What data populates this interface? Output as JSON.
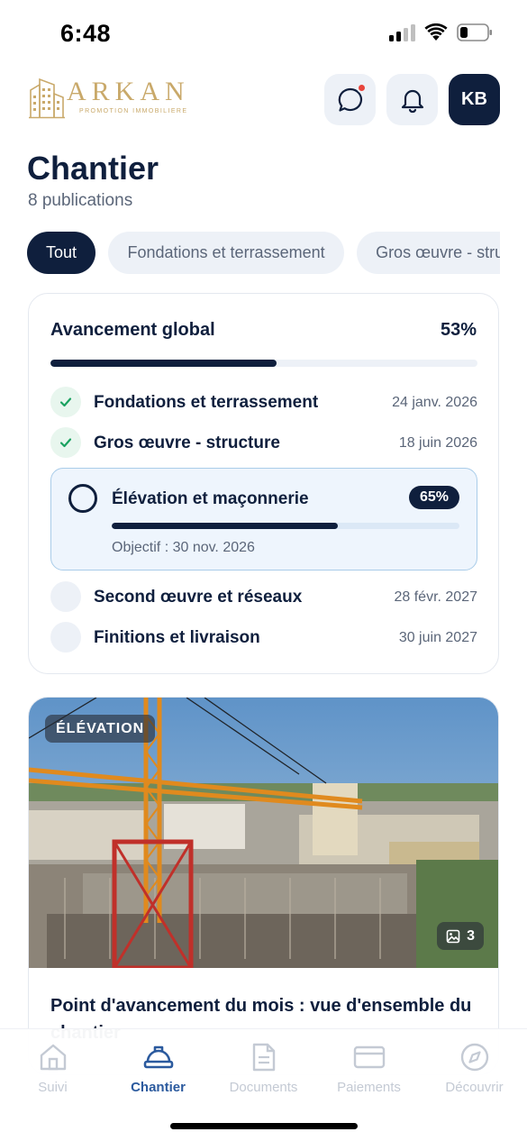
{
  "status_bar": {
    "time": "6:48"
  },
  "brand": {
    "name": "ARKAN",
    "tagline": "PROMOTION IMMOBILIERE",
    "color": "#c9a96a"
  },
  "header": {
    "avatar_initials": "KB",
    "chat_icon": "chat-bubble-icon",
    "bell_icon": "bell-icon",
    "has_notification": true
  },
  "page": {
    "title": "Chantier",
    "subtitle": "8 publications"
  },
  "filters": [
    {
      "label": "Tout",
      "active": true
    },
    {
      "label": "Fondations et terrassement",
      "active": false
    },
    {
      "label": "Gros œuvre - structure",
      "active": false
    }
  ],
  "progress": {
    "title": "Avancement global",
    "percent_label": "53%",
    "percent": 53,
    "steps": [
      {
        "label": "Fondations et terrassement",
        "date": "24 janv. 2026",
        "status": "done"
      },
      {
        "label": "Gros œuvre - structure",
        "date": "18 juin 2026",
        "status": "done"
      },
      {
        "label": "Élévation et maçonnerie",
        "badge": "65%",
        "percent": 65,
        "objective": "Objectif : 30 nov. 2026",
        "status": "current"
      },
      {
        "label": "Second œuvre et réseaux",
        "date": "28 févr. 2027",
        "status": "pending"
      },
      {
        "label": "Finitions et livraison",
        "date": "30 juin 2027",
        "status": "pending"
      }
    ]
  },
  "post": {
    "tag": "ÉLÉVATION",
    "photo_count": "3",
    "title": "Point d'avancement du mois : vue d'ensemble du chantier"
  },
  "nav": [
    {
      "label": "Suivi",
      "icon": "home-icon",
      "active": false
    },
    {
      "label": "Chantier",
      "icon": "hard-hat-icon",
      "active": true
    },
    {
      "label": "Documents",
      "icon": "document-icon",
      "active": false
    },
    {
      "label": "Paiements",
      "icon": "credit-card-icon",
      "active": false
    },
    {
      "label": "Découvrir",
      "icon": "compass-icon",
      "active": false
    }
  ],
  "colors": {
    "primary": "#0f1f3d",
    "accent_blue": "#2b5a9e",
    "success": "#1aa260",
    "notification": "#e8453c"
  }
}
